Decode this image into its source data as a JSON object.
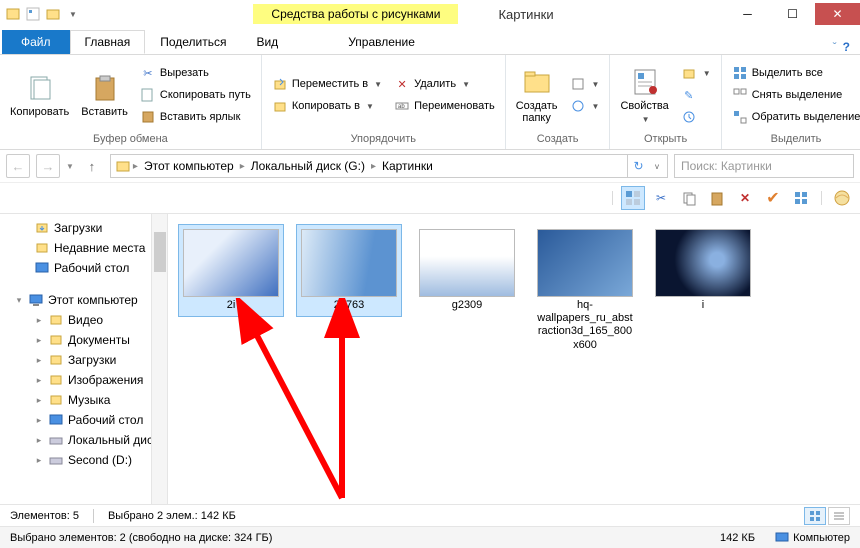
{
  "titlebar": {
    "contextual_label": "Средства работы с рисунками",
    "window_title": "Картинки"
  },
  "tabs": {
    "file": "Файл",
    "home": "Главная",
    "share": "Поделиться",
    "view": "Вид",
    "manage": "Управление"
  },
  "ribbon": {
    "clipboard": {
      "copy": "Копировать",
      "paste": "Вставить",
      "cut": "Вырезать",
      "copy_path": "Скопировать путь",
      "paste_shortcut": "Вставить ярлык",
      "group_label": "Буфер обмена"
    },
    "organize": {
      "move_to": "Переместить в",
      "copy_to": "Копировать в",
      "delete": "Удалить",
      "rename": "Переименовать",
      "group_label": "Упорядочить"
    },
    "new": {
      "new_folder": "Создать папку",
      "group_label": "Создать"
    },
    "open": {
      "properties": "Свойства",
      "group_label": "Открыть"
    },
    "select": {
      "select_all": "Выделить все",
      "select_none": "Снять выделение",
      "invert_selection": "Обратить выделение",
      "group_label": "Выделить"
    }
  },
  "breadcrumb": {
    "items": [
      "Этот компьютер",
      "Локальный диск (G:)",
      "Картинки"
    ]
  },
  "search": {
    "placeholder": "Поиск: Картинки"
  },
  "navpane": {
    "downloads": "Загрузки",
    "recent": "Недавние места",
    "desktop": "Рабочий стол",
    "this_pc": "Этот компьютер",
    "videos": "Видео",
    "documents": "Документы",
    "downloads2": "Загрузки",
    "pictures": "Изображения",
    "music": "Музыка",
    "desktop2": "Рабочий стол",
    "local_disk": "Локальный диск",
    "second_d": "Second (D:)"
  },
  "files": [
    {
      "name": "2i",
      "selected": true,
      "thumb": "t1"
    },
    {
      "name": "20763",
      "selected": true,
      "thumb": "t2"
    },
    {
      "name": "g2309",
      "selected": false,
      "thumb": "t3"
    },
    {
      "name": "hq-wallpapers_ru_abstraction3d_165_800x600",
      "selected": false,
      "thumb": "t4"
    },
    {
      "name": "i",
      "selected": false,
      "thumb": "t5"
    }
  ],
  "itemstatus": {
    "count": "Элементов: 5",
    "selected": "Выбрано 2 элем.: 142 КБ"
  },
  "statusbar": {
    "left": "Выбрано элементов: 2 (свободно на диске: 324 ГБ)",
    "size": "142 КБ",
    "location": "Компьютер"
  }
}
